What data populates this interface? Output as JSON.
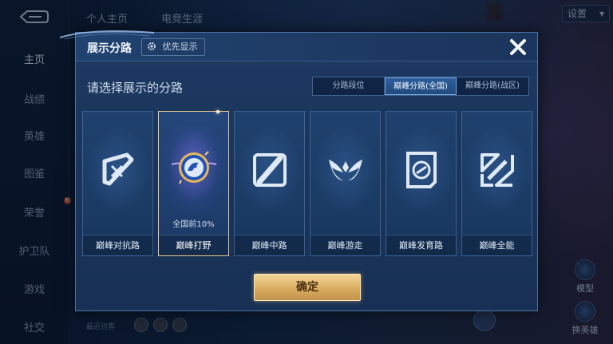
{
  "background": {
    "sidebar": {
      "items": [
        {
          "label": "主页",
          "active": true
        },
        {
          "label": "战绩"
        },
        {
          "label": "英雄"
        },
        {
          "label": "图鉴"
        },
        {
          "label": "荣誉",
          "badge": "新"
        },
        {
          "label": "护卫队"
        },
        {
          "label": "游戏"
        },
        {
          "label": "社交"
        }
      ]
    },
    "top_nav": {
      "tabs": [
        "个人主页",
        "电竞生涯"
      ]
    },
    "settings_label": "设置",
    "right_icons": [
      {
        "label": "模型"
      },
      {
        "label": "换英雄"
      }
    ],
    "recent_visitors_label": "最近访客"
  },
  "modal": {
    "title": "展示分路",
    "priority_label": "优先显示",
    "prompt": "请选择展示的分路",
    "segments": [
      {
        "label": "分路段位"
      },
      {
        "label": "巅峰分路(全国)",
        "selected": true
      },
      {
        "label": "巅峰分路(战区)"
      }
    ],
    "cards": [
      {
        "label": "巅峰对抗路",
        "icon": "clash-lane-icon"
      },
      {
        "label": "巅峰打野",
        "icon": "jungle-dragon-icon",
        "selected": true,
        "rank_text": "全国前10%"
      },
      {
        "label": "巅峰中路",
        "icon": "mid-lane-icon"
      },
      {
        "label": "巅峰游走",
        "icon": "roam-wings-icon"
      },
      {
        "label": "巅峰发育路",
        "icon": "farm-lane-icon"
      },
      {
        "label": "巅峰全能",
        "icon": "all-round-icon"
      }
    ],
    "confirm_label": "确定"
  },
  "colors": {
    "accent_gold": "#e9c88f",
    "panel_blue": "#1e3a62",
    "confirm_gold": "#d9ae62"
  }
}
